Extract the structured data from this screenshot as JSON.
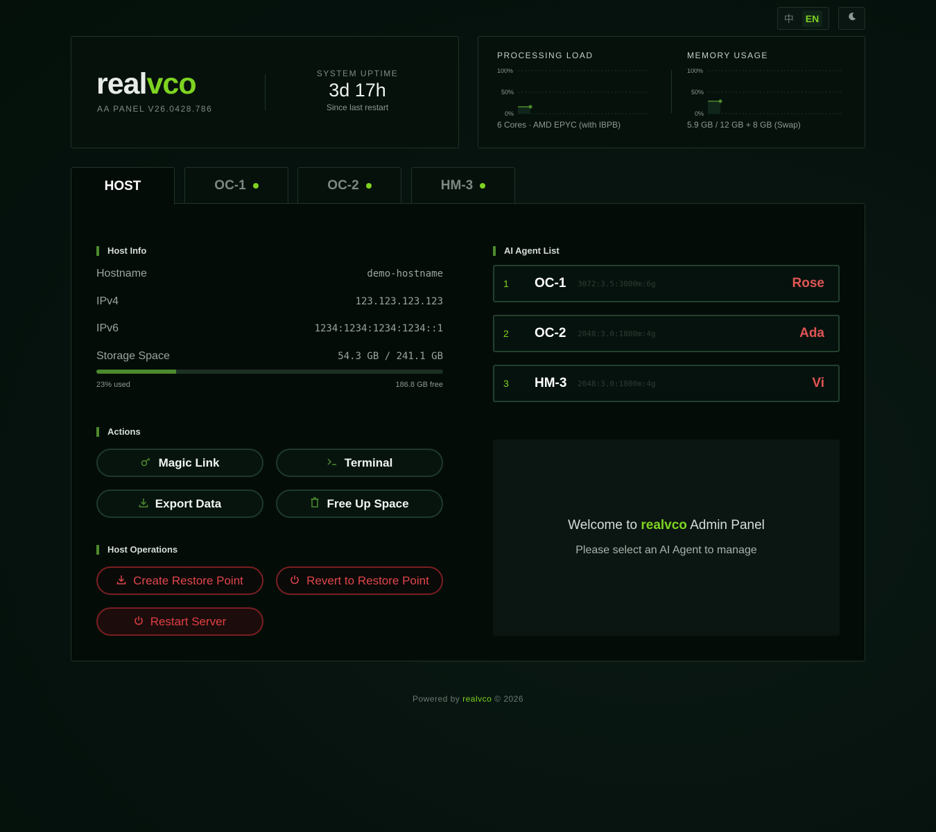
{
  "lang": {
    "zh": "中",
    "en": "EN"
  },
  "icons": {
    "theme": "moon-icon",
    "magic": "key-icon",
    "terminal": "terminal-icon",
    "export": "download-icon",
    "free": "trash-icon",
    "restore": "download-icon",
    "power": "power-icon"
  },
  "colors": {
    "accent": "#7ed321",
    "danger": "#e0454b",
    "background": "#06120e"
  },
  "brand": {
    "logo_a": "real",
    "logo_b": "vco",
    "version": "AA PANEL V26.0428.786"
  },
  "uptime": {
    "label": "SYSTEM UPTIME",
    "value": "3d 17h",
    "sub": "Since last restart"
  },
  "stats": {
    "cpu": {
      "title": "PROCESSING LOAD",
      "y_labels": [
        "100%",
        "50%",
        "0%"
      ],
      "footer": "6 Cores · AMD EPYC (with IBPB)",
      "level_percent": 13
    },
    "mem": {
      "title": "MEMORY USAGE",
      "y_labels": [
        "100%",
        "50%",
        "0%"
      ],
      "footer": "5.9 GB / 12 GB + 8 GB (Swap)",
      "level_percent": 29
    }
  },
  "tabs": [
    {
      "label": "HOST",
      "active": true,
      "online": false
    },
    {
      "label": "OC-1",
      "active": false,
      "online": true
    },
    {
      "label": "OC-2",
      "active": false,
      "online": true
    },
    {
      "label": "HM-3",
      "active": false,
      "online": true
    }
  ],
  "host_info": {
    "title": "Host Info",
    "rows": [
      {
        "key": "Hostname",
        "value": "demo-hostname"
      },
      {
        "key": "IPv4",
        "value": "123.123.123.123"
      },
      {
        "key": "IPv6",
        "value": "1234:1234:1234:1234::1"
      },
      {
        "key": "Storage Space",
        "value": "54.3 GB / 241.1 GB"
      }
    ],
    "storage_used_percent": 23,
    "storage_used_label": "23% used",
    "storage_free_label": "186.8 GB free"
  },
  "actions": {
    "title": "Actions",
    "magic_link": "Magic Link",
    "terminal": "Terminal",
    "export_data": "Export Data",
    "free_up_space": "Free Up Space"
  },
  "host_ops": {
    "title": "Host Operations",
    "create_restore": "Create Restore Point",
    "revert_restore": "Revert to Restore Point",
    "restart": "Restart Server"
  },
  "agents": {
    "title": "AI Agent List",
    "items": [
      {
        "index": "1",
        "name": "OC-1",
        "spec": "3072:3.5:3000m:6g",
        "owner": "Rose"
      },
      {
        "index": "2",
        "name": "OC-2",
        "spec": "2048:3.0:1800m:4g",
        "owner": "Ada"
      },
      {
        "index": "3",
        "name": "HM-3",
        "spec": "2048:3.0:1800m:4g",
        "owner": "Vi"
      }
    ]
  },
  "welcome": {
    "prefix": "Welcome to ",
    "brand": "realvco",
    "suffix": " Admin Panel",
    "sub": "Please select an AI Agent to manage"
  },
  "footer": {
    "prefix": "Powered by ",
    "brand": "realvco",
    "suffix": " © 2026"
  }
}
